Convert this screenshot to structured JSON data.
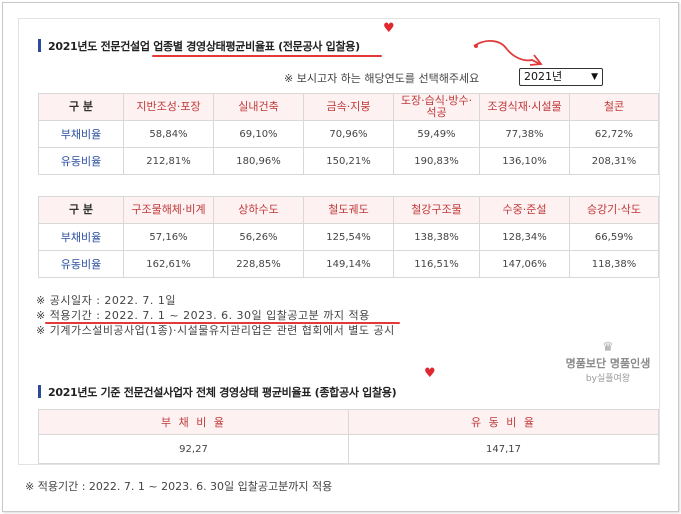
{
  "section1": {
    "title": "2021년도 전문건설업 업종별 경영상태평균비율표 (전문공사 입찰용)"
  },
  "year_selector": {
    "prompt": "※ 보시고자 하는 해당연도를 선택해주세요",
    "selected": "2021년"
  },
  "table1": {
    "headers": [
      "구 분",
      "지반조성·포장",
      "실내건축",
      "금속·지붕",
      "도장·습식·방수·석공",
      "조경식재·시설물",
      "철콘"
    ],
    "rows": [
      {
        "label": "부채비율",
        "values": [
          "58,84%",
          "69,10%",
          "70,96%",
          "59,49%",
          "77,38%",
          "62,72%"
        ]
      },
      {
        "label": "유동비율",
        "values": [
          "212,81%",
          "180,96%",
          "150,21%",
          "190,83%",
          "136,10%",
          "208,31%"
        ]
      }
    ]
  },
  "table2": {
    "headers": [
      "구 분",
      "구조물해체·비계",
      "상하수도",
      "철도궤도",
      "철강구조물",
      "수중·준설",
      "승강기·삭도"
    ],
    "rows": [
      {
        "label": "부채비율",
        "values": [
          "57,16%",
          "56,26%",
          "125,54%",
          "138,38%",
          "128,34%",
          "66,59%"
        ]
      },
      {
        "label": "유동비율",
        "values": [
          "162,61%",
          "228,85%",
          "149,14%",
          "116,51%",
          "147,06%",
          "118,38%"
        ]
      }
    ]
  },
  "notes": [
    "※ 공시일자 : 2022. 7. 1일",
    "※ 적용기간 : 2022. 7. 1 ~ 2023. 6. 30일 입찰공고분 까지 적용",
    "※ 기계가스설비공사업(1종)·시설물유지관리업은 관련 협회에서 별도 공시"
  ],
  "watermark": {
    "main": "명품보단 명품인생",
    "sub": "by실플여왕"
  },
  "section2": {
    "title": "2021년도 기준 전문건설사업자 전체 경영상태 평균비율표 (종합공사 입찰용)"
  },
  "table3": {
    "headers": [
      "부 채 비 율",
      "유 동 비 율"
    ],
    "values": [
      "92,27",
      "147,17"
    ]
  },
  "footer_note": "※ 적용기간 : 2022. 7. 1 ~ 2023. 6. 30일 입찰공고분까지 적용",
  "colors": {
    "accent_red": "#e23a3a",
    "header_bg": "#fdf1f1",
    "header_text": "#c03a3a",
    "label_blue": "#2a4fa0",
    "title_bar": "#2b4a9a"
  }
}
